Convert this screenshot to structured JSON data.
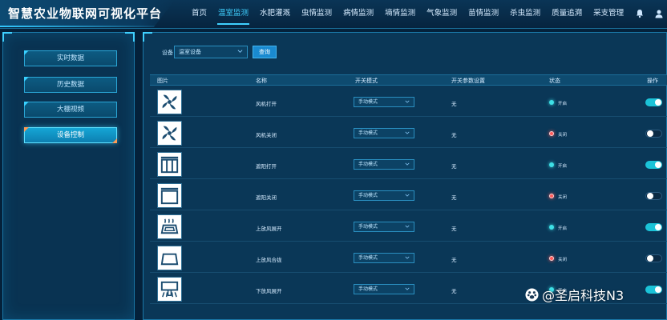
{
  "header": {
    "title": "智慧农业物联网可视化平台",
    "nav": [
      {
        "label": "首页",
        "active": false
      },
      {
        "label": "温室监测",
        "active": true
      },
      {
        "label": "水肥灌溉",
        "active": false
      },
      {
        "label": "虫情监测",
        "active": false
      },
      {
        "label": "病情监测",
        "active": false
      },
      {
        "label": "墒情监测",
        "active": false
      },
      {
        "label": "气象监测",
        "active": false
      },
      {
        "label": "苗情监测",
        "active": false
      },
      {
        "label": "杀虫监测",
        "active": false
      },
      {
        "label": "质量追溯",
        "active": false
      },
      {
        "label": "采支管理",
        "active": false
      }
    ],
    "icons": [
      "bell-icon",
      "user-icon"
    ]
  },
  "sidebar": {
    "items": [
      {
        "label": "实时数据",
        "active": false
      },
      {
        "label": "历史数据",
        "active": false
      },
      {
        "label": "大棚视频",
        "active": false
      },
      {
        "label": "设备控制",
        "active": true
      }
    ]
  },
  "filter": {
    "label": "设备",
    "device_value": "温室设备",
    "query_label": "查询"
  },
  "table": {
    "headers": {
      "image": "图片",
      "name": "名称",
      "mode": "开关模式",
      "params": "开关参数设置",
      "status": "状态",
      "action": "操作"
    },
    "rows": [
      {
        "icon": "fan-icon",
        "name": "风机打开",
        "mode": "手动模式",
        "params": "无",
        "status": "开启",
        "on": true
      },
      {
        "icon": "fan-icon",
        "name": "风机关闭",
        "mode": "手动模式",
        "params": "无",
        "status": "关闭",
        "on": false
      },
      {
        "icon": "curtain-open-icon",
        "name": "遮阳打开",
        "mode": "手动模式",
        "params": "无",
        "status": "开启",
        "on": true
      },
      {
        "icon": "curtain-closed-icon",
        "name": "遮阳关闭",
        "mode": "手动模式",
        "params": "无",
        "status": "关闭",
        "on": false
      },
      {
        "icon": "top-vent-open-icon",
        "name": "上放风展开",
        "mode": "手动模式",
        "params": "无",
        "status": "开启",
        "on": true
      },
      {
        "icon": "top-vent-closed-icon",
        "name": "上放风合拢",
        "mode": "手动模式",
        "params": "无",
        "status": "关闭",
        "on": false
      },
      {
        "icon": "bottom-vent-open-icon",
        "name": "下放风展开",
        "mode": "手动模式",
        "params": "无",
        "status": "开启",
        "on": true
      }
    ]
  },
  "colors": {
    "accent": "#3fd0ff",
    "status_on": "#3ee0e6",
    "status_off": "#ff5a5a",
    "toggle_on": "#1bc3d8"
  },
  "watermark": {
    "text": "@圣启科技N3"
  }
}
